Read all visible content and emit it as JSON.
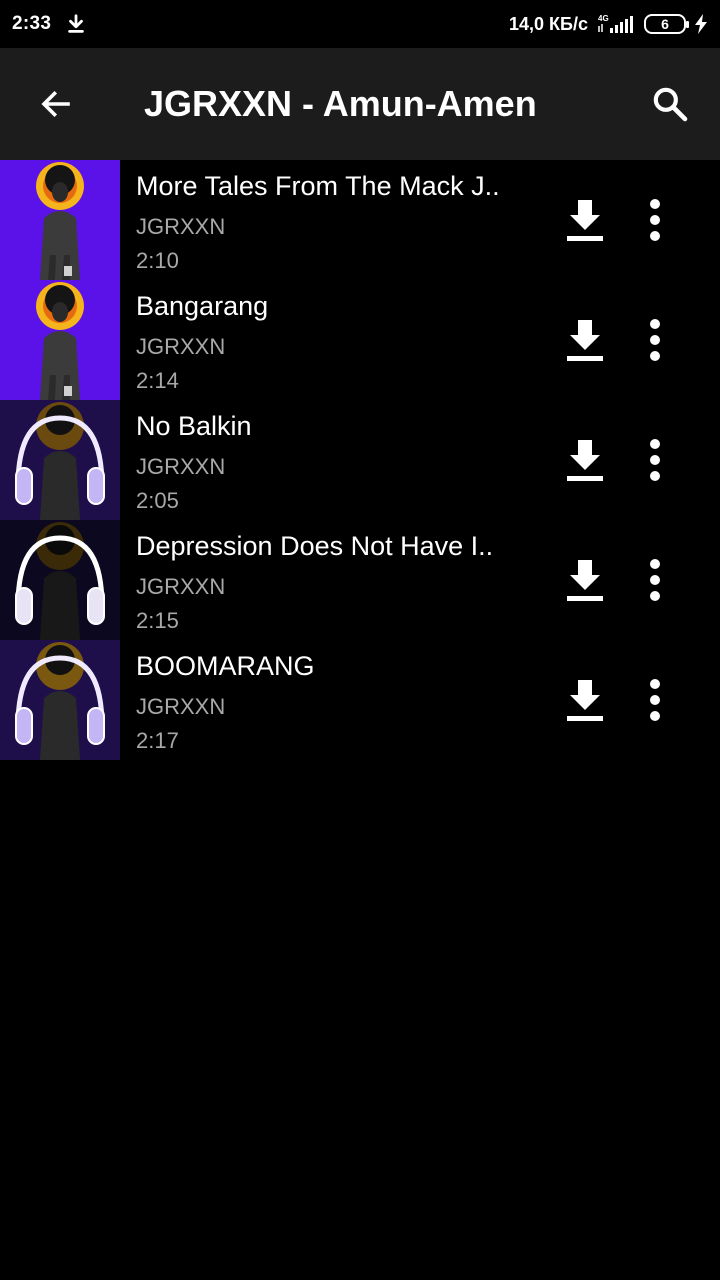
{
  "status_bar": {
    "time": "2:33",
    "speed": "14,0 КБ/с",
    "network": "4G",
    "battery": "6"
  },
  "app_bar": {
    "title": "JGRXXN - Amun-Amen"
  },
  "songs": [
    {
      "title": "More Tales From The Mack J..",
      "artist": "JGRXXN",
      "duration": "2:10",
      "thumb_style": "purple"
    },
    {
      "title": "Bangarang",
      "artist": "JGRXXN",
      "duration": "2:14",
      "thumb_style": "purple"
    },
    {
      "title": "No Balkin",
      "artist": "JGRXXN",
      "duration": "2:05",
      "thumb_style": "headphones"
    },
    {
      "title": "Depression Does Not Have I..",
      "artist": "JGRXXN",
      "duration": "2:15",
      "thumb_style": "headphones-dark"
    },
    {
      "title": "BOOMARANG",
      "artist": "JGRXXN",
      "duration": "2:17",
      "thumb_style": "headphones"
    }
  ],
  "colors": {
    "app_bar_bg": "#1c1c1c",
    "thumb_purple": "#5a12e8",
    "thumb_dark": "#1e0f4a",
    "halo": "#f5b41c",
    "secondary_text": "#a8a8a8"
  },
  "icons": {
    "back": "arrow-left-icon",
    "search": "search-icon",
    "download": "download-icon",
    "more": "more-vertical-icon"
  }
}
